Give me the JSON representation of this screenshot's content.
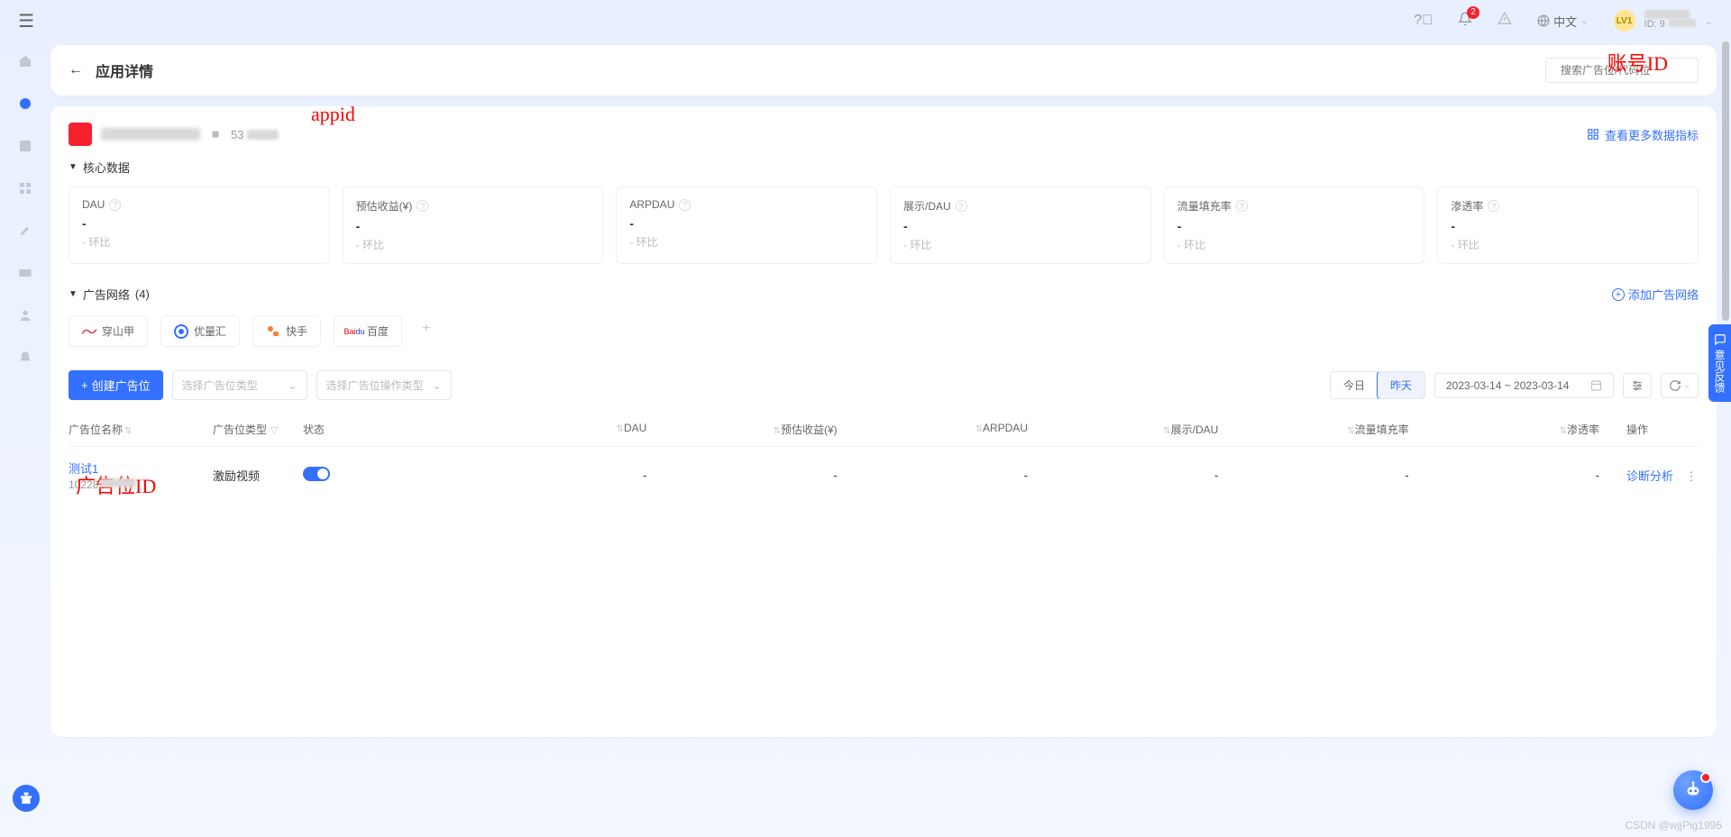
{
  "topbar": {
    "notification_count": "2",
    "language": "中文",
    "user_level": "LV1",
    "user_id_prefix": "ID: 9"
  },
  "annotations": {
    "account_id": "账号ID",
    "app_id": "appid",
    "ad_slot_id": "广告位ID"
  },
  "header": {
    "title": "应用详情",
    "search_placeholder": "搜索广告位/代码位"
  },
  "app": {
    "id_prefix": "53",
    "view_more": "查看更多数据指标"
  },
  "core_data": {
    "label": "核心数据",
    "metrics": [
      {
        "title": "DAU",
        "value": "-",
        "sub": "- 环比"
      },
      {
        "title": "预估收益(¥)",
        "value": "-",
        "sub": "- 环比"
      },
      {
        "title": "ARPDAU",
        "value": "-",
        "sub": "- 环比"
      },
      {
        "title": "展示/DAU",
        "value": "-",
        "sub": "- 环比"
      },
      {
        "title": "流量填充率",
        "value": "-",
        "sub": "- 环比"
      },
      {
        "title": "渗透率",
        "value": "-",
        "sub": "- 环比"
      }
    ]
  },
  "ad_networks": {
    "label": "广告网络",
    "count": "(4)",
    "add_label": "添加广告网络",
    "items": [
      "穿山甲",
      "优量汇",
      "快手",
      "百度"
    ]
  },
  "toolbar": {
    "create_label": "创建广告位",
    "select_type": "选择广告位类型",
    "select_op_type": "选择广告位操作类型",
    "today": "今日",
    "yesterday": "昨天",
    "date_range": "2023-03-14 ~ 2023-03-14"
  },
  "table": {
    "cols": {
      "name": "广告位名称",
      "type": "广告位类型",
      "status": "状态",
      "dau": "DAU",
      "rev": "预估收益(¥)",
      "arpdau": "ARPDAU",
      "show": "展示/DAU",
      "fill": "流量填充率",
      "pen": "渗透率",
      "act": "操作"
    },
    "row": {
      "name": "测试1",
      "id_prefix": "10228",
      "type": "激励视频",
      "dau": "-",
      "rev": "-",
      "arpdau": "-",
      "show": "-",
      "fill": "-",
      "pen": "-",
      "action": "诊断分析"
    }
  },
  "feedback": "意见反馈",
  "watermark": "CSDN @wjjPig1995"
}
